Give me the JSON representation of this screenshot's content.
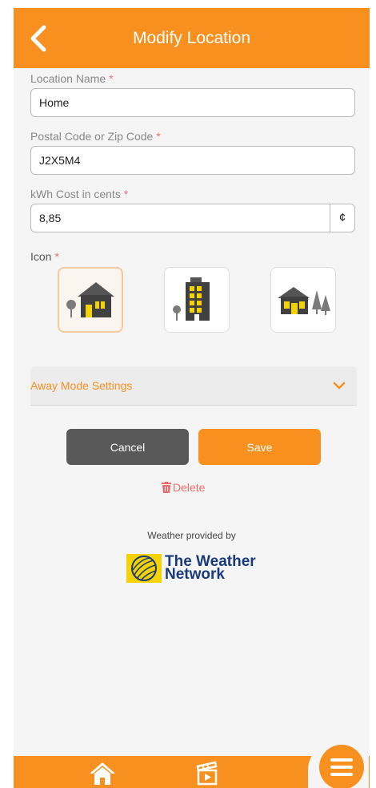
{
  "header": {
    "title": "Modify Location"
  },
  "form": {
    "location_name": {
      "label": "Location Name",
      "required_mark": "*",
      "value": "Home"
    },
    "postal_code": {
      "label": "Postal Code or Zip Code",
      "required_mark": "*",
      "value": "J2X5M4"
    },
    "kwh_cost": {
      "label": "kWh Cost in cents",
      "required_mark": "*",
      "value": "8,85",
      "unit": "¢"
    },
    "icon": {
      "label": "Icon",
      "required_mark": "*",
      "options": [
        "house-icon",
        "apartment-icon",
        "cottage-icon"
      ],
      "selected": "house-icon"
    }
  },
  "away_mode": {
    "label": "Away Mode Settings"
  },
  "actions": {
    "cancel_label": "Cancel",
    "save_label": "Save",
    "delete_label": "Delete"
  },
  "footer": {
    "weather_provided_by": "Weather provided by",
    "provider_line1": "The Weather",
    "provider_line2": "Network"
  },
  "colors": {
    "accent": "#f7901e",
    "cancel": "#595959",
    "delete": "#f26b6b",
    "logo_blue": "#1a3b7a",
    "logo_yellow": "#f5d300"
  }
}
